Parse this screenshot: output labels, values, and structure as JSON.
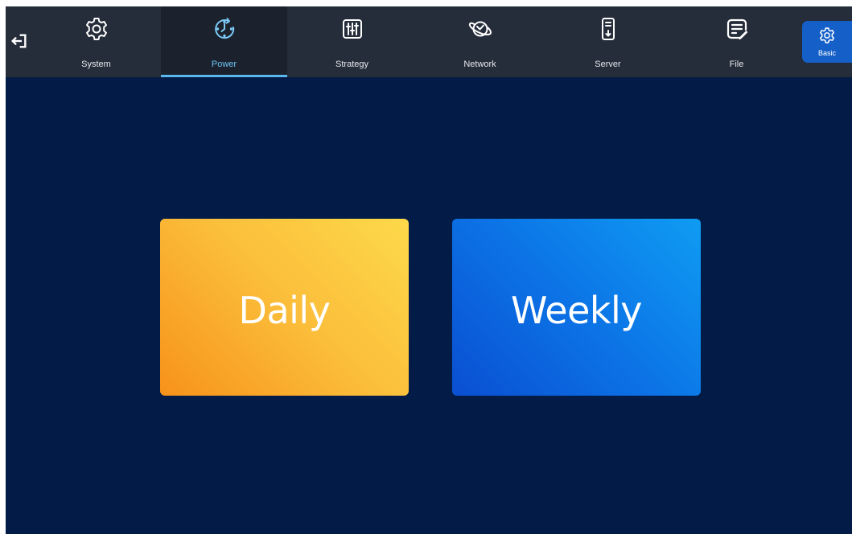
{
  "nav": {
    "back_icon": "exit-arrow-icon",
    "tabs": [
      {
        "label": "System",
        "icon": "gear-icon"
      },
      {
        "label": "Power",
        "icon": "clock-refresh-icon",
        "active": true
      },
      {
        "label": "Strategy",
        "icon": "sliders-icon"
      },
      {
        "label": "Network",
        "icon": "planet-icon"
      },
      {
        "label": "Server",
        "icon": "server-icon"
      },
      {
        "label": "File",
        "icon": "file-edit-icon"
      }
    ],
    "basic": {
      "label": "Basic",
      "icon": "gear-icon"
    }
  },
  "main": {
    "cards": [
      {
        "label": "Daily"
      },
      {
        "label": "Weekly"
      }
    ]
  },
  "colors": {
    "background": "#021c47",
    "topbar": "#252d3a",
    "active_tab": "#1b222d",
    "accent": "#5bb8ee",
    "basic_button": "#1560c8",
    "daily_card_start": "#f7921a",
    "daily_card_end": "#fdd94a",
    "weekly_card_start": "#0a4fd2",
    "weekly_card_end": "#0f9cf3"
  }
}
